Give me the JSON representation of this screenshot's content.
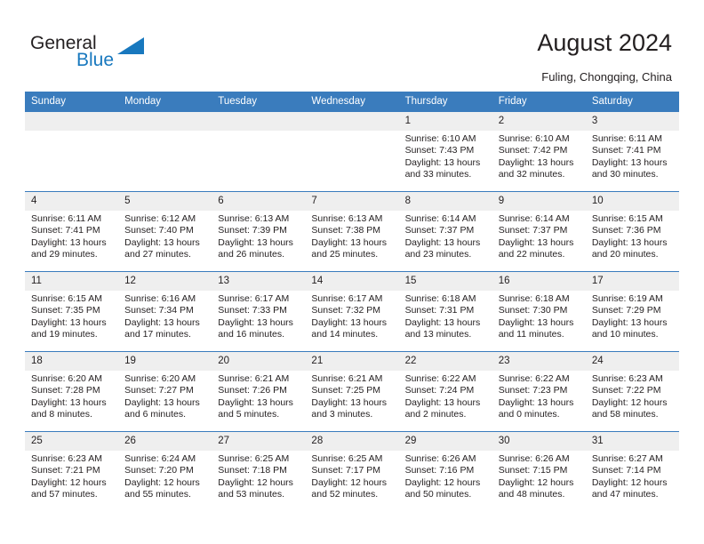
{
  "logo": {
    "word1": "General",
    "word2": "Blue",
    "triangle_color": "#1878be"
  },
  "header": {
    "title": "August 2024",
    "subtitle": "Fuling, Chongqing, China"
  },
  "theme": {
    "header_blue": "#3a7cbd",
    "daynum_gray": "#efefef",
    "text": "#231f20"
  },
  "calendar": {
    "weekday_headers": [
      "Sunday",
      "Monday",
      "Tuesday",
      "Wednesday",
      "Thursday",
      "Friday",
      "Saturday"
    ],
    "weeks": [
      [
        {
          "day": "",
          "empty": true,
          "lines": []
        },
        {
          "day": "",
          "empty": true,
          "lines": []
        },
        {
          "day": "",
          "empty": true,
          "lines": []
        },
        {
          "day": "",
          "empty": true,
          "lines": []
        },
        {
          "day": "1",
          "lines": [
            "Sunrise: 6:10 AM",
            "Sunset: 7:43 PM",
            "Daylight: 13 hours",
            "and 33 minutes."
          ]
        },
        {
          "day": "2",
          "lines": [
            "Sunrise: 6:10 AM",
            "Sunset: 7:42 PM",
            "Daylight: 13 hours",
            "and 32 minutes."
          ]
        },
        {
          "day": "3",
          "lines": [
            "Sunrise: 6:11 AM",
            "Sunset: 7:41 PM",
            "Daylight: 13 hours",
            "and 30 minutes."
          ]
        }
      ],
      [
        {
          "day": "4",
          "lines": [
            "Sunrise: 6:11 AM",
            "Sunset: 7:41 PM",
            "Daylight: 13 hours",
            "and 29 minutes."
          ]
        },
        {
          "day": "5",
          "lines": [
            "Sunrise: 6:12 AM",
            "Sunset: 7:40 PM",
            "Daylight: 13 hours",
            "and 27 minutes."
          ]
        },
        {
          "day": "6",
          "lines": [
            "Sunrise: 6:13 AM",
            "Sunset: 7:39 PM",
            "Daylight: 13 hours",
            "and 26 minutes."
          ]
        },
        {
          "day": "7",
          "lines": [
            "Sunrise: 6:13 AM",
            "Sunset: 7:38 PM",
            "Daylight: 13 hours",
            "and 25 minutes."
          ]
        },
        {
          "day": "8",
          "lines": [
            "Sunrise: 6:14 AM",
            "Sunset: 7:37 PM",
            "Daylight: 13 hours",
            "and 23 minutes."
          ]
        },
        {
          "day": "9",
          "lines": [
            "Sunrise: 6:14 AM",
            "Sunset: 7:37 PM",
            "Daylight: 13 hours",
            "and 22 minutes."
          ]
        },
        {
          "day": "10",
          "lines": [
            "Sunrise: 6:15 AM",
            "Sunset: 7:36 PM",
            "Daylight: 13 hours",
            "and 20 minutes."
          ]
        }
      ],
      [
        {
          "day": "11",
          "lines": [
            "Sunrise: 6:15 AM",
            "Sunset: 7:35 PM",
            "Daylight: 13 hours",
            "and 19 minutes."
          ]
        },
        {
          "day": "12",
          "lines": [
            "Sunrise: 6:16 AM",
            "Sunset: 7:34 PM",
            "Daylight: 13 hours",
            "and 17 minutes."
          ]
        },
        {
          "day": "13",
          "lines": [
            "Sunrise: 6:17 AM",
            "Sunset: 7:33 PM",
            "Daylight: 13 hours",
            "and 16 minutes."
          ]
        },
        {
          "day": "14",
          "lines": [
            "Sunrise: 6:17 AM",
            "Sunset: 7:32 PM",
            "Daylight: 13 hours",
            "and 14 minutes."
          ]
        },
        {
          "day": "15",
          "lines": [
            "Sunrise: 6:18 AM",
            "Sunset: 7:31 PM",
            "Daylight: 13 hours",
            "and 13 minutes."
          ]
        },
        {
          "day": "16",
          "lines": [
            "Sunrise: 6:18 AM",
            "Sunset: 7:30 PM",
            "Daylight: 13 hours",
            "and 11 minutes."
          ]
        },
        {
          "day": "17",
          "lines": [
            "Sunrise: 6:19 AM",
            "Sunset: 7:29 PM",
            "Daylight: 13 hours",
            "and 10 minutes."
          ]
        }
      ],
      [
        {
          "day": "18",
          "lines": [
            "Sunrise: 6:20 AM",
            "Sunset: 7:28 PM",
            "Daylight: 13 hours",
            "and 8 minutes."
          ]
        },
        {
          "day": "19",
          "lines": [
            "Sunrise: 6:20 AM",
            "Sunset: 7:27 PM",
            "Daylight: 13 hours",
            "and 6 minutes."
          ]
        },
        {
          "day": "20",
          "lines": [
            "Sunrise: 6:21 AM",
            "Sunset: 7:26 PM",
            "Daylight: 13 hours",
            "and 5 minutes."
          ]
        },
        {
          "day": "21",
          "lines": [
            "Sunrise: 6:21 AM",
            "Sunset: 7:25 PM",
            "Daylight: 13 hours",
            "and 3 minutes."
          ]
        },
        {
          "day": "22",
          "lines": [
            "Sunrise: 6:22 AM",
            "Sunset: 7:24 PM",
            "Daylight: 13 hours",
            "and 2 minutes."
          ]
        },
        {
          "day": "23",
          "lines": [
            "Sunrise: 6:22 AM",
            "Sunset: 7:23 PM",
            "Daylight: 13 hours",
            "and 0 minutes."
          ]
        },
        {
          "day": "24",
          "lines": [
            "Sunrise: 6:23 AM",
            "Sunset: 7:22 PM",
            "Daylight: 12 hours",
            "and 58 minutes."
          ]
        }
      ],
      [
        {
          "day": "25",
          "lines": [
            "Sunrise: 6:23 AM",
            "Sunset: 7:21 PM",
            "Daylight: 12 hours",
            "and 57 minutes."
          ]
        },
        {
          "day": "26",
          "lines": [
            "Sunrise: 6:24 AM",
            "Sunset: 7:20 PM",
            "Daylight: 12 hours",
            "and 55 minutes."
          ]
        },
        {
          "day": "27",
          "lines": [
            "Sunrise: 6:25 AM",
            "Sunset: 7:18 PM",
            "Daylight: 12 hours",
            "and 53 minutes."
          ]
        },
        {
          "day": "28",
          "lines": [
            "Sunrise: 6:25 AM",
            "Sunset: 7:17 PM",
            "Daylight: 12 hours",
            "and 52 minutes."
          ]
        },
        {
          "day": "29",
          "lines": [
            "Sunrise: 6:26 AM",
            "Sunset: 7:16 PM",
            "Daylight: 12 hours",
            "and 50 minutes."
          ]
        },
        {
          "day": "30",
          "lines": [
            "Sunrise: 6:26 AM",
            "Sunset: 7:15 PM",
            "Daylight: 12 hours",
            "and 48 minutes."
          ]
        },
        {
          "day": "31",
          "lines": [
            "Sunrise: 6:27 AM",
            "Sunset: 7:14 PM",
            "Daylight: 12 hours",
            "and 47 minutes."
          ]
        }
      ]
    ]
  }
}
